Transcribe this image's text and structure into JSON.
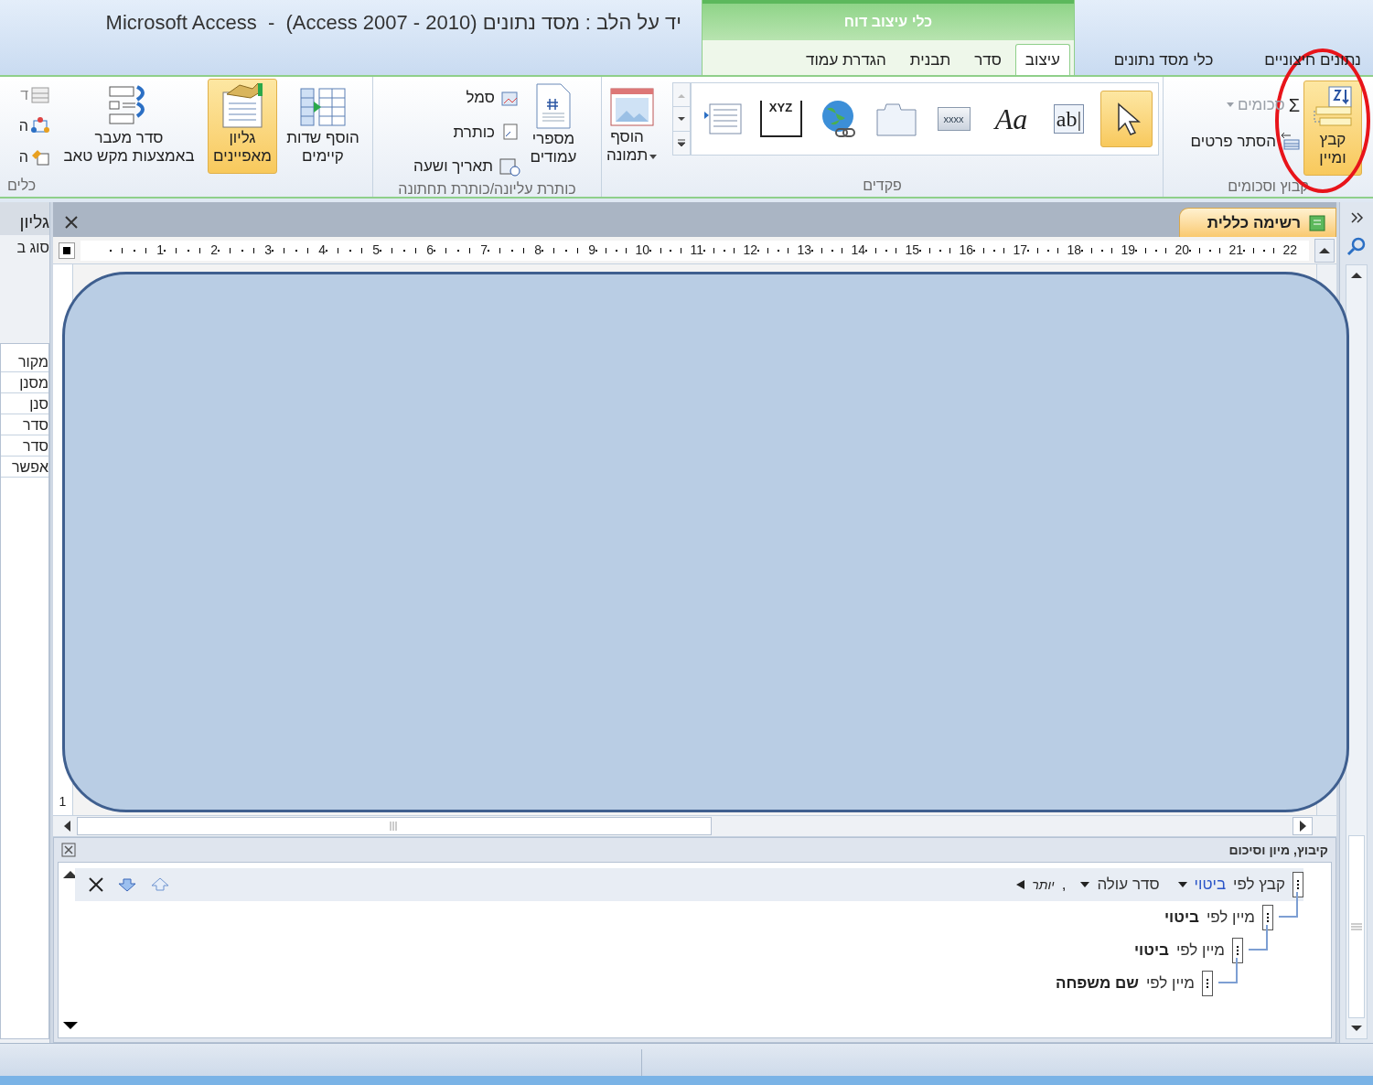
{
  "window": {
    "title": "יד על הלב : מסד נתונים (Access 2007 - 2010)  -  Microsoft Access"
  },
  "context_tab_group": {
    "title": "כלי עיצוב דוח"
  },
  "tabs": [
    {
      "label": "נתונים חיצוניים",
      "selected": false,
      "contextual": false
    },
    {
      "label": "כלי מסד נתונים",
      "selected": false,
      "contextual": false
    },
    {
      "label": "עיצוב",
      "selected": true,
      "contextual": true
    },
    {
      "label": "סדר",
      "selected": false,
      "contextual": true
    },
    {
      "label": "תבנית",
      "selected": false,
      "contextual": true
    },
    {
      "label": "הגדרת עמוד",
      "selected": false,
      "contextual": true
    }
  ],
  "ribbon": {
    "groups": [
      {
        "label": "קבוץ וסכומים",
        "items": [
          {
            "label": "קבץ\nומיין",
            "selected": true
          },
          {
            "label": "סכומים",
            "glyph": "Σ",
            "disabled": true
          },
          {
            "label": "הסתר פרטים",
            "disabled": false
          }
        ]
      },
      {
        "label": "פקדים",
        "gallery": [
          {
            "selected": true
          },
          {
            "glyph": "ab|",
            "selected": false
          },
          {
            "glyph": "Aa",
            "selected": false
          },
          {
            "glyph": "xxxx",
            "selected": false
          },
          {
            "selected": false
          },
          {
            "selected": false
          },
          {
            "glyph": "XYZ",
            "selected": false
          },
          {
            "selected": false
          }
        ],
        "items": [
          {
            "label": "הוסף\nתמונה"
          }
        ]
      },
      {
        "label": "כותרת עליונה/כותרת תחתונה",
        "items": [
          {
            "label": "מספרי\nעמודים"
          },
          {
            "label": "סמל"
          },
          {
            "label": "כותרת"
          },
          {
            "label": "תאריך ושעה"
          }
        ]
      },
      {
        "label": "כלים",
        "items": [
          {
            "label": "הוסף שדות\nקיימים",
            "selected": false
          },
          {
            "label": "גליון\nמאפיינים",
            "selected": true
          },
          {
            "label": "סדר מעבר\nבאמצעות מקש טאב",
            "selected": false
          },
          {
            "label": "ד"
          },
          {
            "label": "ה"
          },
          {
            "label": "ה"
          }
        ]
      }
    ]
  },
  "property_sheet": {
    "title": "גליון",
    "subtitle": "סוג ב",
    "rows": [
      "מקור",
      "מסנן",
      "סנן",
      "סדר",
      "סדר",
      "אפשר"
    ]
  },
  "document_tab": {
    "label": "רשימה כללית",
    "selected": true
  },
  "ruler": [
    "22",
    "21",
    "20",
    "19",
    "18",
    "17",
    "16",
    "15",
    "14",
    "13",
    "12",
    "11",
    "10",
    "9",
    "8",
    "7",
    "6",
    "5",
    "4",
    "3",
    "2",
    "1"
  ],
  "side_ruler_mark": "1",
  "group_pane": {
    "title": "קיבוץ, מיון וסיכום",
    "levels": [
      {
        "kind": "group",
        "prefix": "קבץ לפי",
        "field": "ביטוי",
        "order": "סדר עולה",
        "separator": ",",
        "more": "יותר",
        "selected": true,
        "children": [
          {
            "kind": "sort",
            "prefix": "מיין לפי",
            "field": "ביטוי",
            "selected": false,
            "children": [
              {
                "kind": "sort",
                "prefix": "מיין לפי",
                "field": "ביטוי",
                "selected": false,
                "children": [
                  {
                    "kind": "sort",
                    "prefix": "מיין לפי",
                    "field": "שם משפחה",
                    "selected": false
                  }
                ]
              }
            ]
          }
        ]
      }
    ]
  }
}
